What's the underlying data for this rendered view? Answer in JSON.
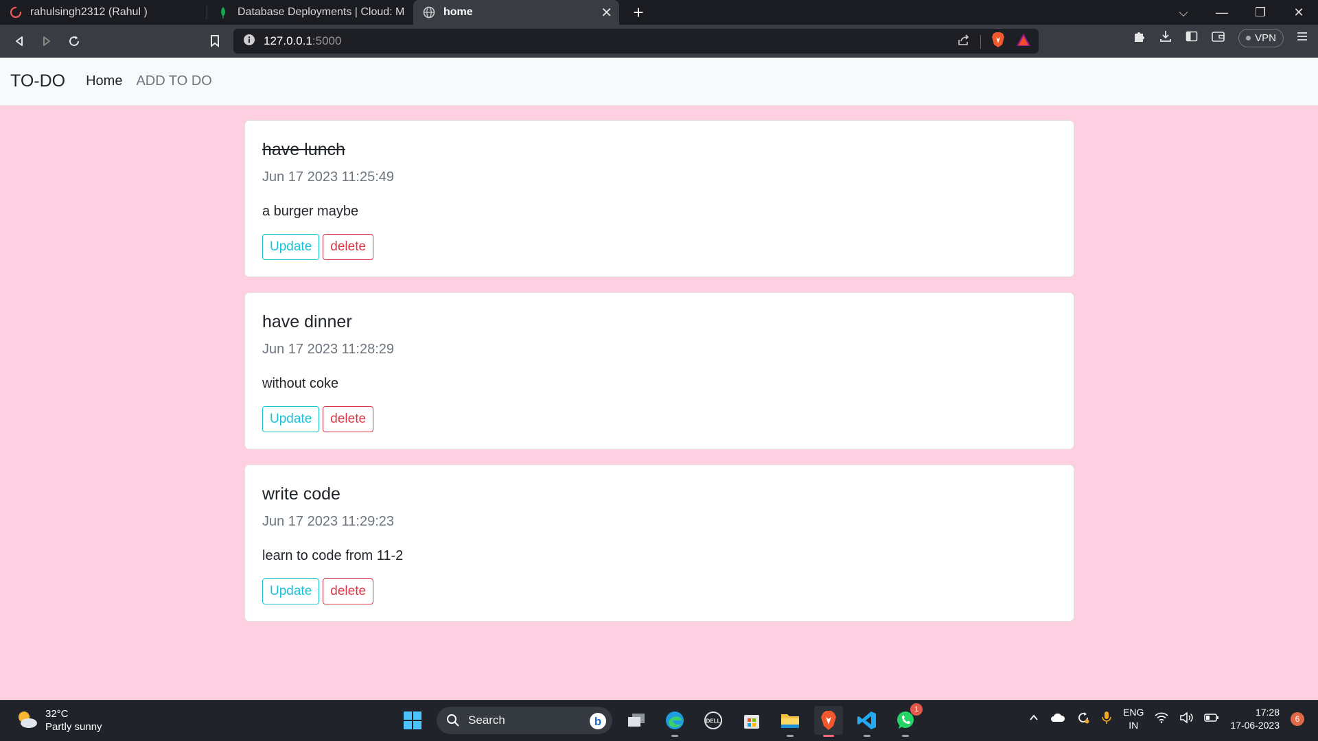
{
  "browser": {
    "tabs": [
      {
        "title": "rahulsingh2312 (Rahul )",
        "active": false
      },
      {
        "title": "Database Deployments | Cloud: Mongo",
        "active": false
      },
      {
        "title": "home",
        "active": true
      }
    ],
    "url_host": "127.0.0.1",
    "url_port": ":5000",
    "vpn_label": "VPN"
  },
  "navbar": {
    "brand": "TO-DO",
    "links": [
      {
        "label": "Home",
        "active": true
      },
      {
        "label": "ADD TO DO",
        "active": false
      }
    ]
  },
  "todos": [
    {
      "title": "have lunch",
      "completed": true,
      "date": "Jun 17 2023 11:25:49",
      "description": "a burger maybe",
      "update_label": "Update",
      "delete_label": "delete"
    },
    {
      "title": "have dinner",
      "completed": false,
      "date": "Jun 17 2023 11:28:29",
      "description": "without coke",
      "update_label": "Update",
      "delete_label": "delete"
    },
    {
      "title": "write code",
      "completed": false,
      "date": "Jun 17 2023 11:29:23",
      "description": "learn to code from 11-2",
      "update_label": "Update",
      "delete_label": "delete"
    }
  ],
  "taskbar": {
    "weather_temp": "32°C",
    "weather_desc": "Partly sunny",
    "search_label": "Search",
    "whatsapp_badge": "1",
    "lang_1": "ENG",
    "lang_2": "IN",
    "time": "17:28",
    "date": "17-06-2023",
    "notification_count": "6"
  },
  "colors": {
    "page_bg": "#fecfe0",
    "update_btn": "#17c1d6",
    "delete_btn": "#dc3545"
  }
}
